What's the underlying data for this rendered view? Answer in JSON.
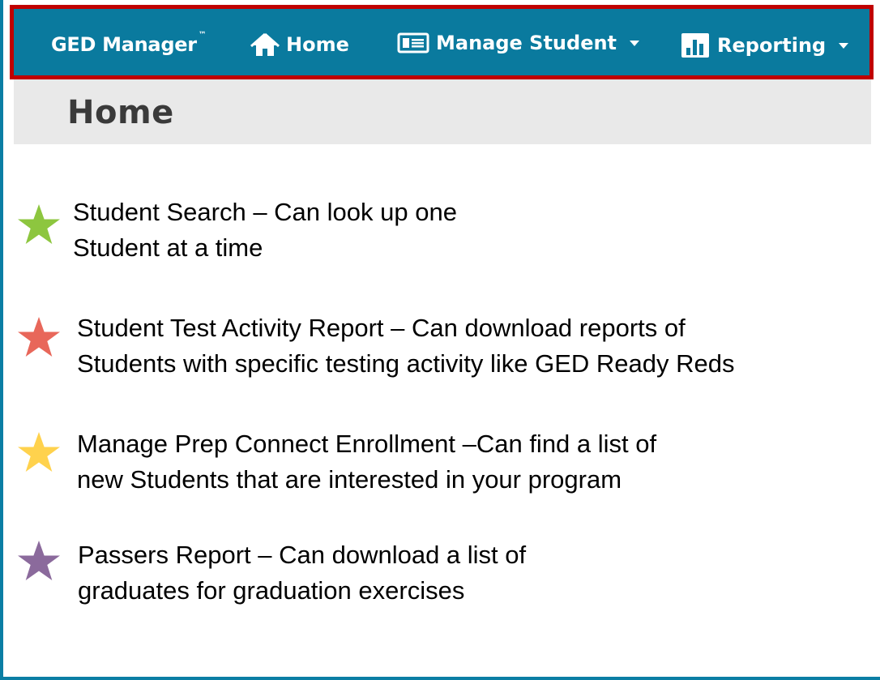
{
  "navbar": {
    "brand": "GED Manager",
    "brand_mark": "™",
    "home_label": "Home",
    "manage_student_label": "Manage Student",
    "reporting_label": "Reporting"
  },
  "page": {
    "title": "Home"
  },
  "features": [
    {
      "line1": "Student Search – Can look up one",
      "line2": "Student at a time",
      "star_color": "#8dc63f"
    },
    {
      "line1": "Student Test Activity Report – Can download reports of",
      "line2": "Students with specific testing activity like GED Ready Reds",
      "star_color": "#e8675a"
    },
    {
      "line1": "Manage Prep Connect Enrollment –Can find a list of",
      "line2": "new Students that are interested in your program",
      "star_color": "#ffd24d"
    },
    {
      "line1": "Passers Report – Can download a list of",
      "line2": "graduates for graduation exercises",
      "star_color": "#8b6a9c"
    }
  ],
  "colors": {
    "navbar_bg": "#0a7a9e",
    "highlight_border": "#c00000",
    "title_bar_bg": "#e9e9e9"
  }
}
